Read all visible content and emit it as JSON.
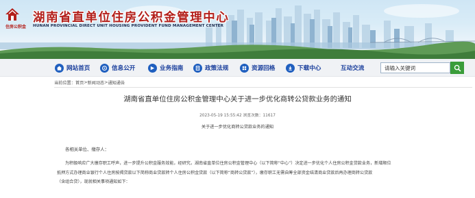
{
  "header": {
    "logo_sub": "住房公积金",
    "title_cn": "湖南省直单位住房公积金管理中心",
    "title_en": "HUNAN PROVINCIAL DIRECT UNIT HOUSING PROVIDENT FUND MANAGEMENT CENTER"
  },
  "nav": {
    "items": [
      {
        "label": "网站首页",
        "icon": "home-icon"
      },
      {
        "label": "信息公开",
        "icon": "info-icon"
      },
      {
        "label": "业务指南",
        "icon": "guide-icon"
      },
      {
        "label": "政策法规",
        "icon": "policy-icon"
      },
      {
        "label": "资源回格",
        "icon": "resource-icon"
      },
      {
        "label": "下载中心",
        "icon": "download-icon"
      },
      {
        "label": "互动交流",
        "icon": ""
      }
    ],
    "search_value": "请输入关键词"
  },
  "breadcrumb": {
    "prefix": "当前位置：",
    "items": [
      "首页",
      "新闻动态",
      "通知通告"
    ],
    "separator": ">"
  },
  "article": {
    "title": "湖南省直单位住房公积金管理中心关于进一步优化商转公贷款业务的通知",
    "meta": "2023-05-19 15:55:42  浏览次数：11617",
    "subtitle": "关于进一步优化商转公贷款业务的通知",
    "greeting": "各相关单位、缴存人：",
    "para_lines": [
      "为积极响应广大缴存职工呼声，进一步提升公积金服务效能，经研究，湖南省直单位住房公积金管理中心（以下简称“中心”）决定进一步优化个人住房公积金贷款业务，新增顺位",
      "抵押方式办理商业银行个人住房按揭贷款以下简称商业贷款转个人住房公积金贷款（以下简称“商转公贷款”），缴存职工无需自筹全部资金结清商业贷款后再办理商转公贷款",
      "（含组合贷），现就相关事项通知如下："
    ]
  },
  "colors": {
    "brand_red": "#b3201b",
    "nav_blue": "#1a3f9c",
    "search_green": "#3a9d3a"
  }
}
